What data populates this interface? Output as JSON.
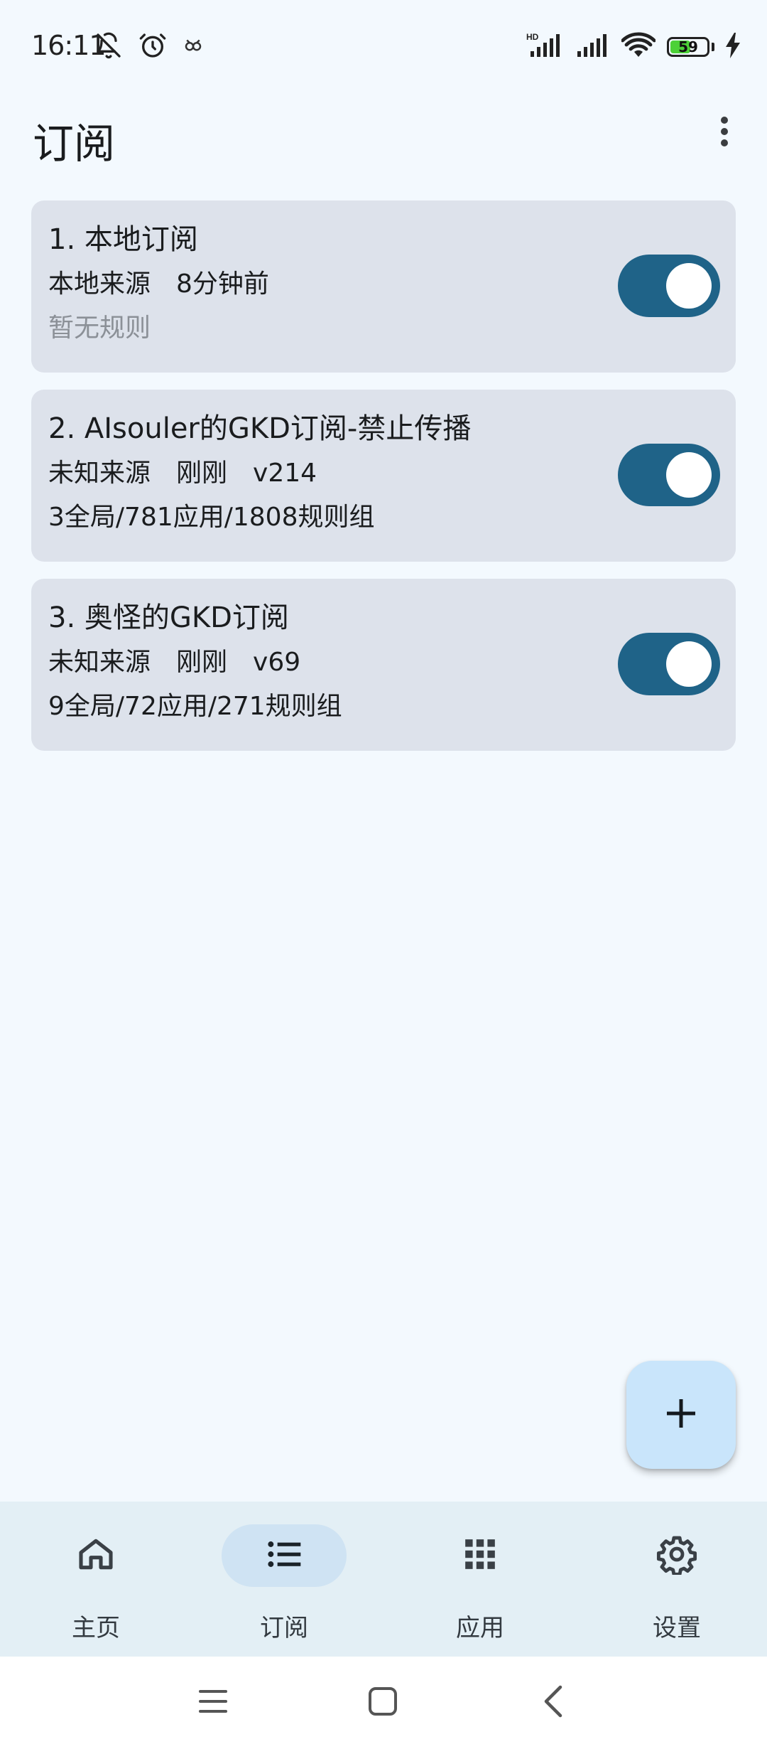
{
  "status_bar": {
    "time": "16:11",
    "battery_level": "59",
    "battery_fraction": 0.59,
    "icons": [
      "bell-off-icon",
      "alarm-icon",
      "app-notification-icon",
      "hd-signal-icon",
      "signal-icon",
      "wifi-icon",
      "battery-icon",
      "charging-icon"
    ]
  },
  "header": {
    "title": "订阅",
    "more_icon": "more-vert-icon"
  },
  "subscriptions": [
    {
      "title": "1. 本地订阅",
      "source": "本地来源",
      "time": "8分钟前",
      "version": "",
      "rules": "暂无规则",
      "enabled": true
    },
    {
      "title": "2. AIsouler的GKD订阅-禁止传播",
      "source": "未知来源",
      "time": "刚刚",
      "version": "v214",
      "rules": "3全局/781应用/1808规则组",
      "enabled": true
    },
    {
      "title": "3. 奥怪的GKD订阅",
      "source": "未知来源",
      "time": "刚刚",
      "version": "v69",
      "rules": "9全局/72应用/271规则组",
      "enabled": true
    }
  ],
  "fab": {
    "icon": "plus-icon"
  },
  "bottom_nav": {
    "items": [
      {
        "label": "主页",
        "icon": "home-icon",
        "active": false
      },
      {
        "label": "订阅",
        "icon": "list-icon",
        "active": true
      },
      {
        "label": "应用",
        "icon": "apps-grid-icon",
        "active": false
      },
      {
        "label": "设置",
        "icon": "settings-gear-icon",
        "active": false
      }
    ]
  },
  "system_nav": {
    "icons": [
      "menu-icon",
      "home-square-icon",
      "back-icon"
    ]
  },
  "colors": {
    "background": "#f3f9fe",
    "card": "#dde2eb",
    "toggle_on": "#1f6388",
    "fab": "#c9e5fb",
    "nav_bar": "#e3eff5",
    "nav_active_pill": "#cfe3f3",
    "muted_text": "#8b9097"
  }
}
